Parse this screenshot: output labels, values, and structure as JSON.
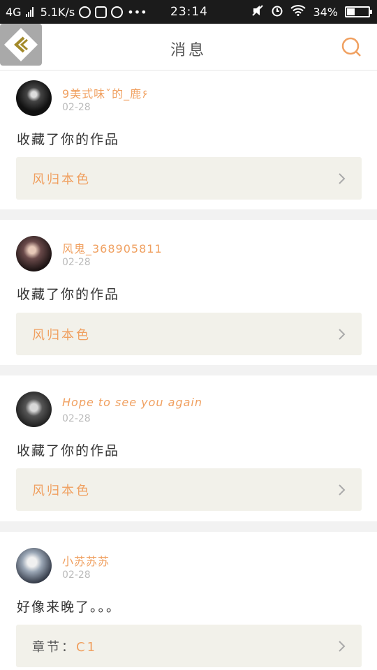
{
  "status_bar": {
    "network": "4G",
    "speed": "5.1K/s",
    "time": "23:14",
    "battery": "34%",
    "battery_level": 0.34
  },
  "header": {
    "title": "消息",
    "back_icon": "back-diamond-icon",
    "search_icon": "search-icon"
  },
  "colors": {
    "accent": "#f0a060",
    "card_link_bg": "#f2f1ea",
    "date": "#bbbbbb"
  },
  "messages": [
    {
      "username": "9美式味ˇ的_鹿۶",
      "date": "02-28",
      "text": "收藏了你的作品",
      "link": {
        "prefix": "",
        "label": "风归本色"
      }
    },
    {
      "username": "风鬼_368905811",
      "date": "02-28",
      "text": "收藏了你的作品",
      "link": {
        "prefix": "",
        "label": "风归本色"
      }
    },
    {
      "username": "Hope to see you again",
      "date": "02-28",
      "text": "收藏了你的作品",
      "link": {
        "prefix": "",
        "label": "风归本色"
      }
    },
    {
      "username": "小苏苏苏",
      "date": "02-28",
      "text": "好像来晚了。。。",
      "link": {
        "prefix": "章节：",
        "label": "C1"
      }
    }
  ]
}
